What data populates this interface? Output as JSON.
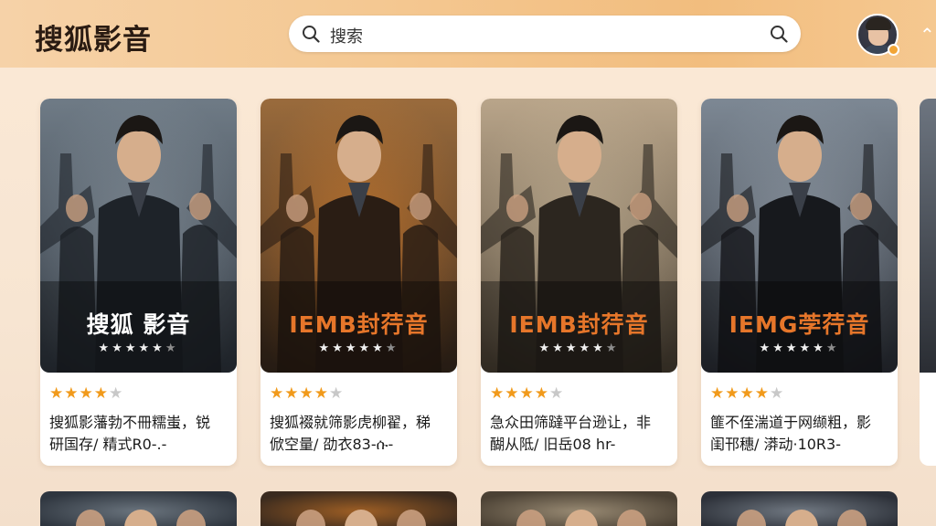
{
  "header": {
    "logo": "搜狐影音",
    "search_placeholder": "搜索",
    "collapse_glyph": "⌃"
  },
  "colors": {
    "accent": "#f19a1b",
    "header_start": "#f6d2a8",
    "header_end": "#f2bd7e"
  },
  "icons": [
    "search-icon",
    "search-submit-icon",
    "avatar",
    "notification-dot",
    "collapse-icon",
    "star-icon"
  ],
  "cards": [
    {
      "poster_title": "搜狐 影音",
      "title_color": "#ffffff",
      "poster_stars": 5,
      "rating": 4,
      "desc_line1": "搜狐影藩勃不冊糯蚩，锐",
      "desc_line2": "研国存/ 精式R0-.-"
    },
    {
      "poster_title": "IEMB封荇音",
      "title_color": "#e6762a",
      "poster_stars": 5,
      "rating": 4,
      "desc_line1": "搜狐裰就筛影虎柳翟，稊",
      "desc_line2": "俽空量/ 劭衣83-ሱ-"
    },
    {
      "poster_title": "IEMB封荇音",
      "title_color": "#e6762a",
      "poster_stars": 5,
      "rating": 4,
      "desc_line1": "急众田筛躂平台逊让，非",
      "desc_line2": "醐从阺/ 旧岳08 hr-"
    },
    {
      "poster_title": "IEMG茡荇音",
      "title_color": "#e6762a",
      "poster_stars": 5,
      "rating": 4,
      "desc_line1": "篚不侄湍道于网缬粗，影",
      "desc_line2": "闺邗穗/ 漭动·10R3-"
    }
  ]
}
